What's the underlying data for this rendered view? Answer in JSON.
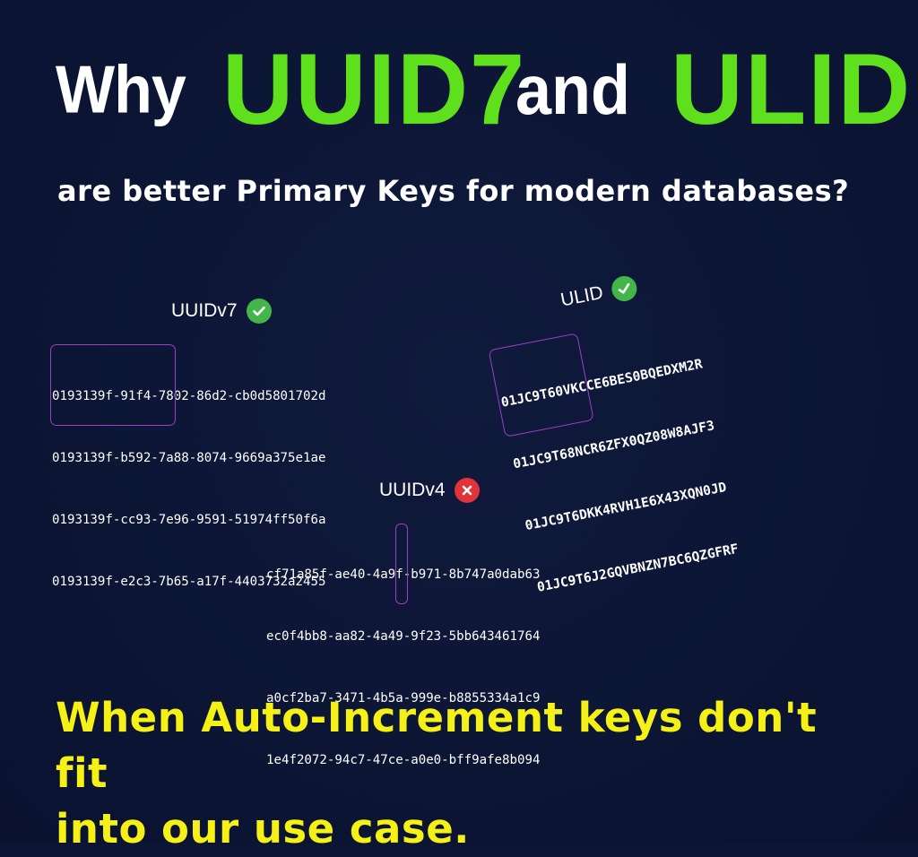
{
  "headline": {
    "word1": "Why",
    "word2": "UUID7",
    "word3": "and",
    "word4": "ULID"
  },
  "subtitle": "are better Primary Keys for modern databases?",
  "uuidv7": {
    "label": "UUIDv7",
    "status_icon": "check-circle-icon",
    "rows": [
      "0193139f-91f4-7802-86d2-cb0d5801702d",
      "0193139f-b592-7a88-8074-9669a375e1ae",
      "0193139f-cc93-7e96-9591-51974ff50f6a",
      "0193139f-e2c3-7b65-a17f-4403732a2455"
    ]
  },
  "ulid": {
    "label": "ULID",
    "status_icon": "check-circle-icon",
    "rows": [
      "01JC9T60VKCCE6BES0BQEDXM2R",
      "01JC9T68NCR6ZFX0QZ08W8AJF3",
      "01JC9T6DKK4RVH1E6X43XQN0JD",
      "01JC9T6J2GQVBNZN7BC6QZGFRF"
    ]
  },
  "uuidv4": {
    "label": "UUIDv4",
    "status_icon": "x-circle-icon",
    "rows": [
      "cf71a85f-ae40-4a9f-b971-8b747a0dab63",
      "ec0f4bb8-aa82-4a49-9f23-5bb643461764",
      "a0cf2ba7-3471-4b5a-999e-b8855334a1c9",
      "1e4f2072-94c7-47ce-a0e0-bff9afe8b094"
    ]
  },
  "tagline_line1": "When Auto-Increment keys don't fit",
  "tagline_line2": "into our use case.",
  "colors": {
    "background": "#0c1534",
    "accent_green": "#5fe01c",
    "tagline_yellow": "#f5f015",
    "highlight_purple": "#9b3fc7",
    "ok_green": "#43b649",
    "bad_red": "#e0333a"
  }
}
